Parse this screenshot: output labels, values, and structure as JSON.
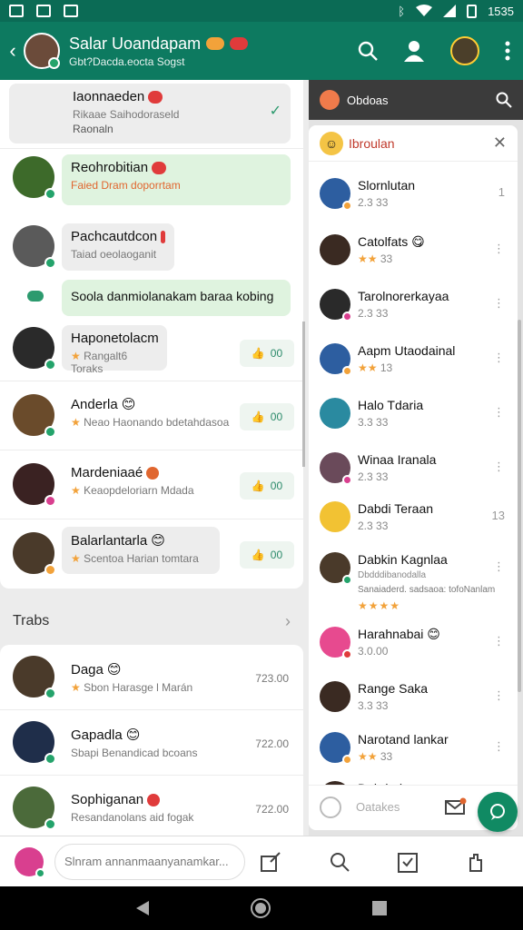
{
  "status": {
    "time": "1535"
  },
  "header": {
    "title": "Salar Uoandapam",
    "subtitle": "Gbt?Dacda.eocta Sogst"
  },
  "chats": [
    {
      "name": "Iaonnaeden",
      "sub": "Rikaae Saihodoraseld",
      "sub2": "Raonaln",
      "status": "✓"
    },
    {
      "name": "Reohrobitian",
      "sub": "Faied Dram doporrtam"
    },
    {
      "name": "Pachcautdcon",
      "sub": "Taiad oeolaoganit"
    },
    {
      "name": "Haponetolacm",
      "sub": "Rangalt6 Toraks",
      "likes": "00"
    },
    {
      "name": "Anderla",
      "sub": "Neao Haonando bdetahdasoa",
      "likes": "00"
    },
    {
      "name": "Mardeniaaé",
      "sub": "Keaopdeloriarn Mdada",
      "likes": "00"
    },
    {
      "name": "Balarlantarla",
      "sub": "Scentoa Harian tomtara",
      "likes": "00"
    }
  ],
  "message": {
    "text": "Soola danmiolanakam baraa kobing"
  },
  "section": {
    "title": "Trabs"
  },
  "recent": [
    {
      "name": "Daga",
      "sub": "Sbon Harasge l Marán",
      "time": "723.00"
    },
    {
      "name": "Gapadla",
      "sub": "Sbapi Benandicad bcoans",
      "time": "722.00"
    },
    {
      "name": "Sophiganan",
      "sub": "Resandanolans aid fogak",
      "time": "722.00"
    }
  ],
  "panel": {
    "title": "Obdoas",
    "tag": "Ibroulan",
    "contacts": [
      {
        "name": "Slornlutan",
        "meta": "2.3 33",
        "more": "1"
      },
      {
        "name": "Catolfats",
        "meta": "33",
        "more": "⋮"
      },
      {
        "name": "Tarolnorerkayaa",
        "meta": "2.3 33",
        "more": "⋮"
      },
      {
        "name": "Aapm Utaodainal",
        "meta": "13",
        "more": "⋮"
      },
      {
        "name": "Halo Tdaria",
        "meta": "3.3 33",
        "more": "⋮"
      },
      {
        "name": "Winaa Iranala",
        "meta": "2.3 33",
        "more": "⋮"
      },
      {
        "name": "Dabdi Teraan",
        "meta": "2.3 33",
        "more": "13"
      },
      {
        "name": "Dabkin Kagnlaa",
        "meta": "Dbdddibanodalla",
        "extra": "Sanaiaderd. sadsaoa: tofoNanlam",
        "stars": "★★★★",
        "more": "⋮"
      },
      {
        "name": "Harahnabai",
        "meta": "3.0.00",
        "more": "⋮"
      },
      {
        "name": "Range Saka",
        "meta": "3.3 33",
        "more": "⋮"
      },
      {
        "name": "Narotand lankar",
        "meta": "33",
        "more": "⋮"
      },
      {
        "name": "Dabrindan",
        "meta": "",
        "more": ""
      }
    ],
    "compose_placeholder": "Oatakes"
  },
  "composer": {
    "placeholder": "Slnram annanmaanyanamkar..."
  },
  "colors": {
    "primary": "#0d7a60",
    "accent": "#108a63",
    "bubble_green": "#dff3df"
  }
}
